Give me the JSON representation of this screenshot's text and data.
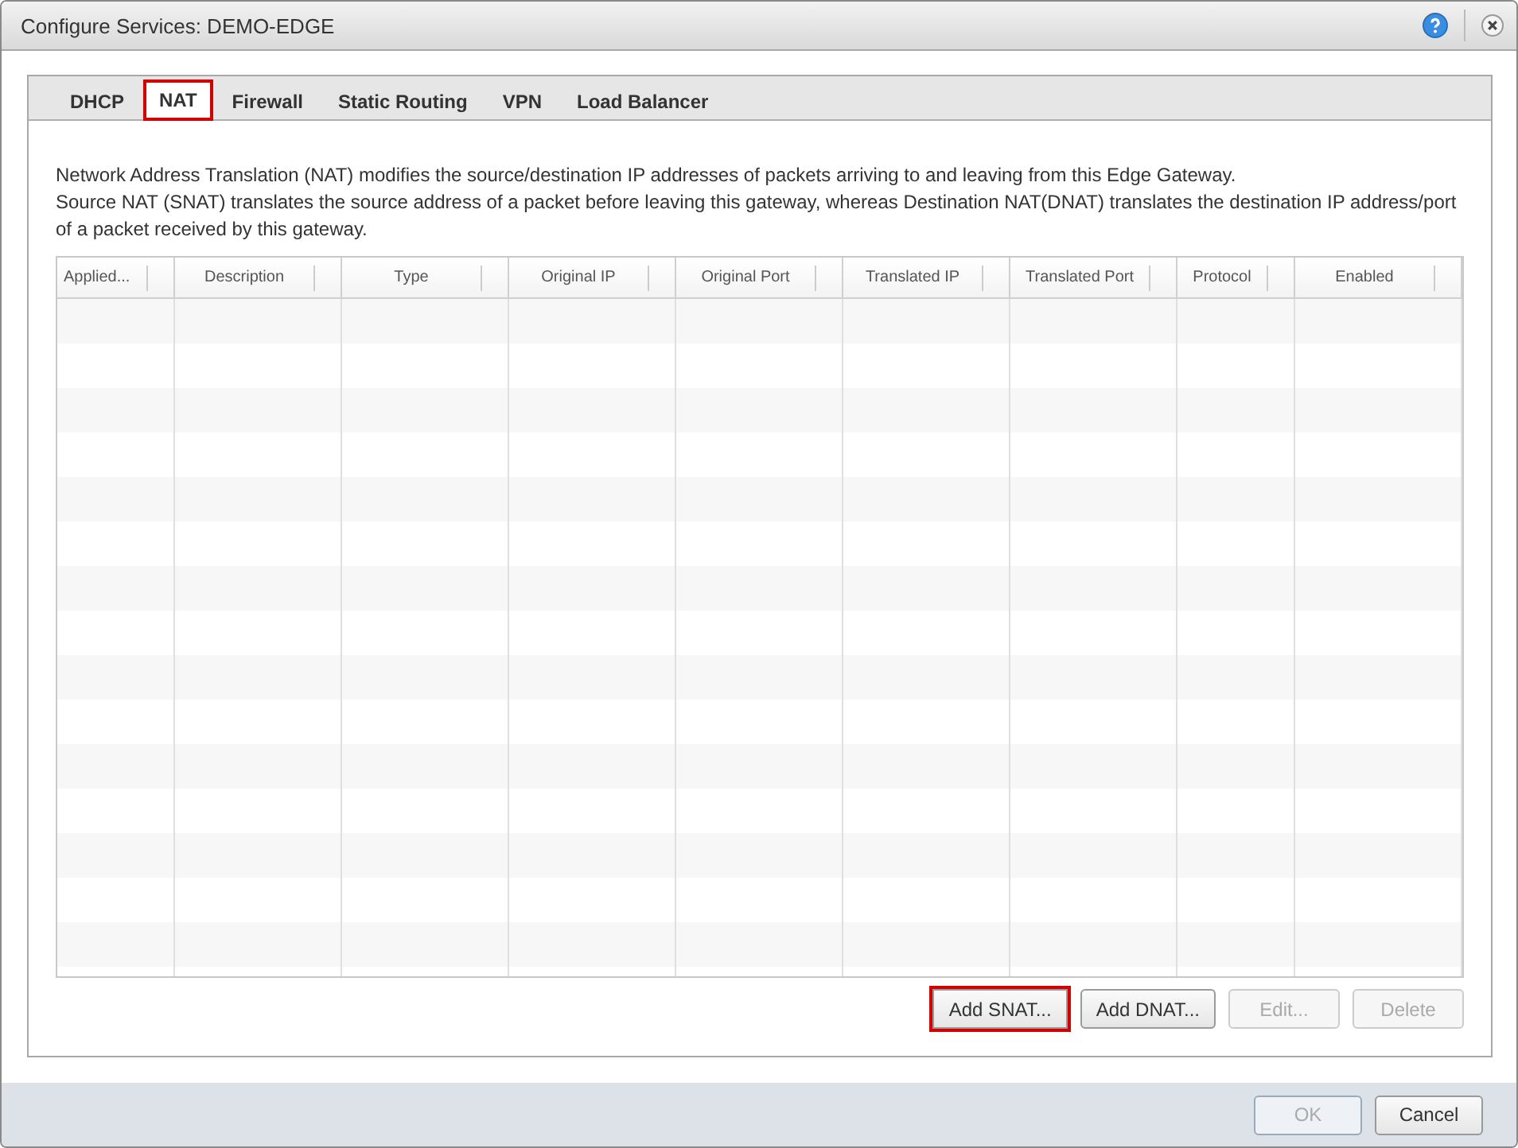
{
  "window": {
    "title": "Configure Services: DEMO-EDGE"
  },
  "tabs": [
    {
      "label": "DHCP",
      "selected": false,
      "highlighted": false
    },
    {
      "label": "NAT",
      "selected": true,
      "highlighted": true
    },
    {
      "label": "Firewall",
      "selected": false,
      "highlighted": false
    },
    {
      "label": "Static Routing",
      "selected": false,
      "highlighted": false
    },
    {
      "label": "VPN",
      "selected": false,
      "highlighted": false
    },
    {
      "label": "Load Balancer",
      "selected": false,
      "highlighted": false
    }
  ],
  "description": [
    "Network Address Translation (NAT) modifies the source/destination IP addresses of packets arriving to and leaving from this Edge Gateway.",
    "Source NAT (SNAT) translates the source address of a packet before leaving this gateway, whereas Destination NAT(DNAT)  translates the destination IP address/port of a packet received by this gateway."
  ],
  "table": {
    "columns": [
      "Applied...",
      "Description",
      "Type",
      "Original IP",
      "Original Port",
      "Translated IP",
      "Translated Port",
      "Protocol",
      "Enabled"
    ]
  },
  "actions": [
    {
      "label": "Add SNAT...",
      "disabled": false,
      "highlighted": true
    },
    {
      "label": "Add DNAT...",
      "disabled": false,
      "highlighted": false
    },
    {
      "label": "Edit...",
      "disabled": true,
      "highlighted": false
    },
    {
      "label": "Delete",
      "disabled": true,
      "highlighted": false
    }
  ],
  "footer_buttons": [
    {
      "label": "OK",
      "disabled": true
    },
    {
      "label": "Cancel",
      "disabled": false
    }
  ]
}
